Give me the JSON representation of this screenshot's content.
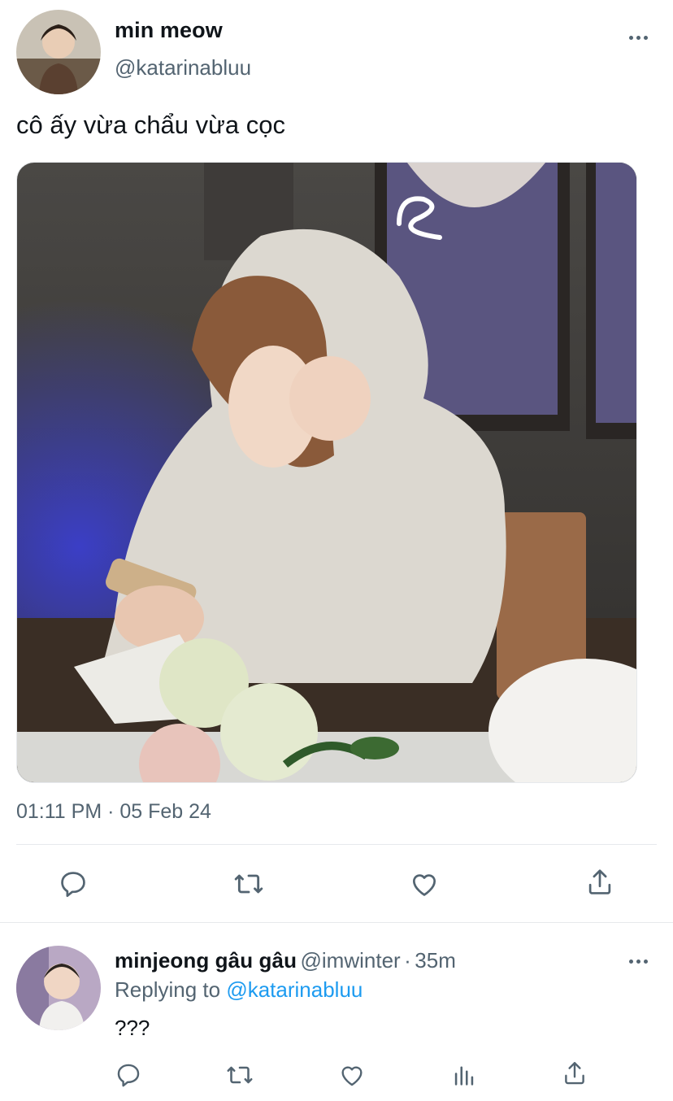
{
  "tweet": {
    "author_name": "min meow",
    "author_handle": "@katarinabluu",
    "text": "cô ấy vừa chẩu vừa cọc",
    "timestamp": "01:11 PM · 05 Feb 24",
    "actions": [
      "reply-icon",
      "retweet-icon",
      "like-icon",
      "share-icon"
    ]
  },
  "reply": {
    "author_name": "minjeong gâu gâu",
    "author_handle": "@imwinter",
    "time_sep": "·",
    "time": "35m",
    "replying_prefix": "Replying to",
    "replying_handle": "@katarinabluu",
    "text": "???",
    "actions": [
      "reply-icon",
      "retweet-icon",
      "like-icon",
      "analytics-icon",
      "share-icon"
    ]
  },
  "colors": {
    "text": "#0f1419",
    "secondary": "#536471",
    "link": "#1d9bf0",
    "divider": "#e6e9ec"
  }
}
